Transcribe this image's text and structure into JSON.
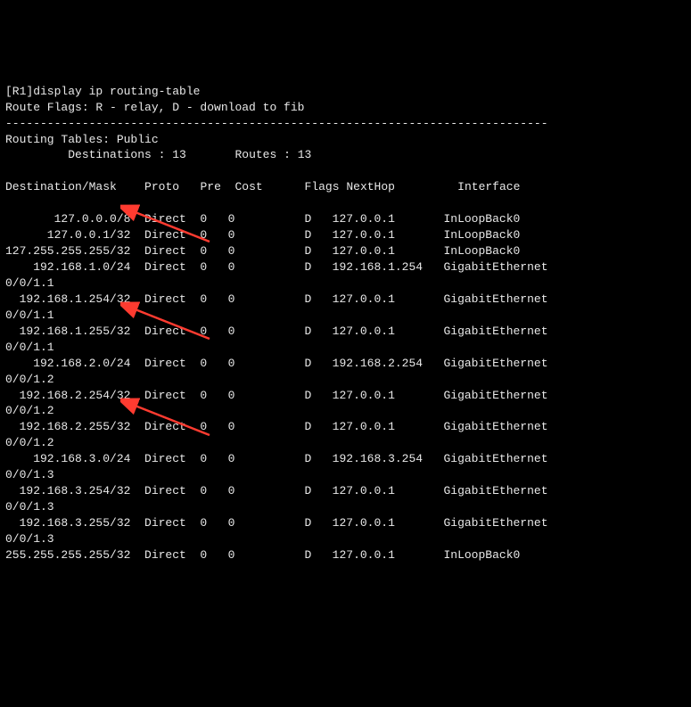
{
  "command": "[R1]display ip routing-table",
  "route_flags": "Route Flags: R - relay, D - download to fib",
  "separator": "------------------------------------------------------------------------------",
  "table_title": "Routing Tables: Public",
  "dest_label": "Destinations : ",
  "dest_count": "13",
  "routes_label": "Routes : ",
  "routes_count": "13",
  "headers": {
    "dest": "Destination/Mask",
    "proto": "Proto",
    "pre": "Pre",
    "cost": "Cost",
    "flags": "Flags",
    "nexthop": "NextHop",
    "interface": "Interface"
  },
  "rows": [
    {
      "dest": "      127.0.0.0/8",
      "proto": "Direct",
      "pre": "0",
      "cost": "0",
      "flags": "D",
      "nexthop": "127.0.0.1",
      "iface": "InLoopBack0",
      "wrap": ""
    },
    {
      "dest": "    127.0.0.1/32",
      "proto": "Direct",
      "pre": "0",
      "cost": "0",
      "flags": "D",
      "nexthop": "127.0.0.1",
      "iface": "InLoopBack0",
      "wrap": ""
    },
    {
      "dest": "127.255.255.255/32",
      "proto": "Direct",
      "pre": "0",
      "cost": "0",
      "flags": "D",
      "nexthop": "127.0.0.1",
      "iface": "InLoopBack0",
      "wrap": ""
    },
    {
      "dest": "   192.168.1.0/24",
      "proto": "Direct",
      "pre": "0",
      "cost": "0",
      "flags": "D",
      "nexthop": "192.168.1.254",
      "iface": "GigabitEthernet",
      "wrap": "0/0/1.1"
    },
    {
      "dest": " 192.168.1.254/32",
      "proto": "Direct",
      "pre": "0",
      "cost": "0",
      "flags": "D",
      "nexthop": "127.0.0.1",
      "iface": "GigabitEthernet",
      "wrap": "0/0/1.1"
    },
    {
      "dest": " 192.168.1.255/32",
      "proto": "Direct",
      "pre": "0",
      "cost": "0",
      "flags": "D",
      "nexthop": "127.0.0.1",
      "iface": "GigabitEthernet",
      "wrap": "0/0/1.1"
    },
    {
      "dest": "   192.168.2.0/24",
      "proto": "Direct",
      "pre": "0",
      "cost": "0",
      "flags": "D",
      "nexthop": "192.168.2.254",
      "iface": "GigabitEthernet",
      "wrap": "0/0/1.2"
    },
    {
      "dest": " 192.168.2.254/32",
      "proto": "Direct",
      "pre": "0",
      "cost": "0",
      "flags": "D",
      "nexthop": "127.0.0.1",
      "iface": "GigabitEthernet",
      "wrap": "0/0/1.2"
    },
    {
      "dest": " 192.168.2.255/32",
      "proto": "Direct",
      "pre": "0",
      "cost": "0",
      "flags": "D",
      "nexthop": "127.0.0.1",
      "iface": "GigabitEthernet",
      "wrap": "0/0/1.2"
    },
    {
      "dest": "   192.168.3.0/24",
      "proto": "Direct",
      "pre": "0",
      "cost": "0",
      "flags": "D",
      "nexthop": "192.168.3.254",
      "iface": "GigabitEthernet",
      "wrap": "0/0/1.3"
    },
    {
      "dest": " 192.168.3.254/32",
      "proto": "Direct",
      "pre": "0",
      "cost": "0",
      "flags": "D",
      "nexthop": "127.0.0.1",
      "iface": "GigabitEthernet",
      "wrap": "0/0/1.3"
    },
    {
      "dest": " 192.168.3.255/32",
      "proto": "Direct",
      "pre": "0",
      "cost": "0",
      "flags": "D",
      "nexthop": "127.0.0.1",
      "iface": "GigabitEthernet",
      "wrap": "0/0/1.3"
    },
    {
      "dest": "255.255.255.255/32",
      "proto": "Direct",
      "pre": "0",
      "cost": "0",
      "flags": "D",
      "nexthop": "127.0.0.1",
      "iface": "InLoopBack0",
      "wrap": ""
    }
  ]
}
